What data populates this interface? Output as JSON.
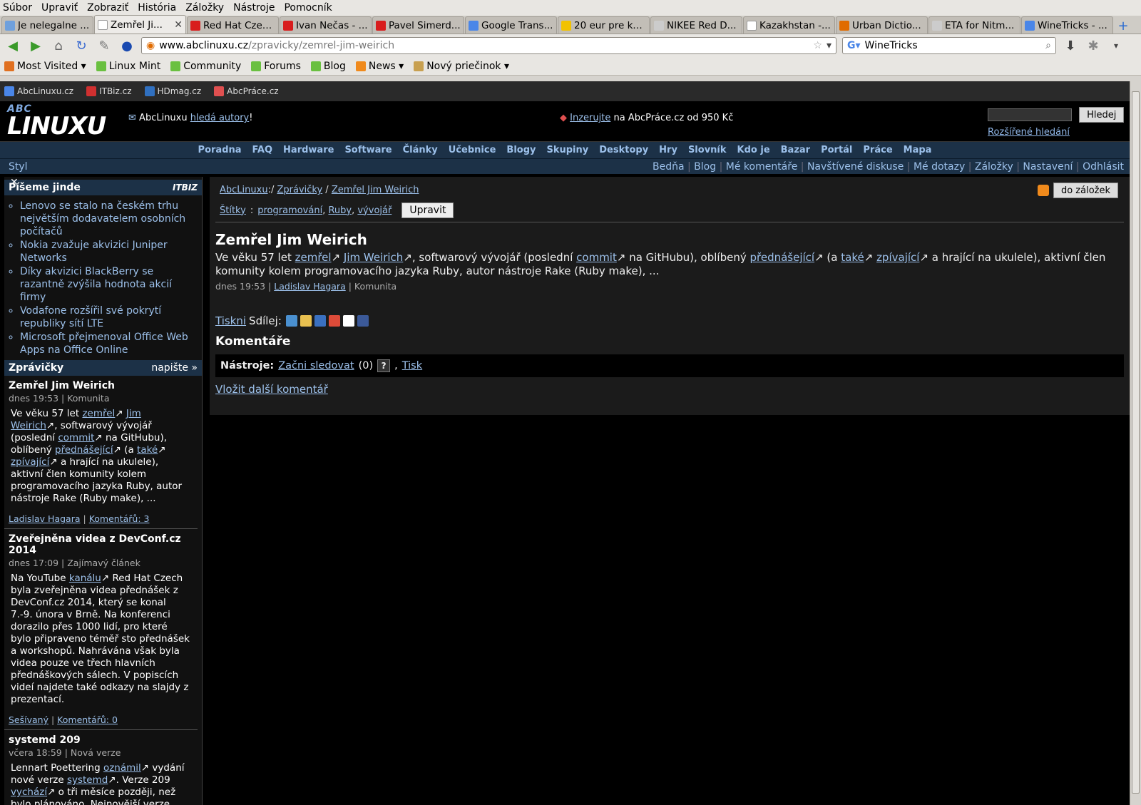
{
  "menubar": [
    "Súbor",
    "Upraviť",
    "Zobraziť",
    "História",
    "Záložky",
    "Nástroje",
    "Pomocník"
  ],
  "tabs": [
    {
      "label": "Je nelegalne ...",
      "color": "#6fa0dc"
    },
    {
      "label": "Zemřel Ji...",
      "color": "#ffffff",
      "active": true
    },
    {
      "label": "Red Hat Czec...",
      "color": "#d81d1d"
    },
    {
      "label": "Ivan Nečas - ...",
      "color": "#d81d1d"
    },
    {
      "label": "Pavel Simerd...",
      "color": "#d81d1d"
    },
    {
      "label": "Google Trans...",
      "color": "#4a86e8"
    },
    {
      "label": "20 eur pre ka...",
      "color": "#f2c200"
    },
    {
      "label": "NIKEE Red D...",
      "color": "#cccccc"
    },
    {
      "label": "Kazakhstan -...",
      "color": "#ffffff"
    },
    {
      "label": "Urban Dictio...",
      "color": "#e06b00"
    },
    {
      "label": "ETA for Nitm...",
      "color": "#cccccc"
    },
    {
      "label": "WineTricks - ...",
      "color": "#4a86e8"
    }
  ],
  "tab_close": "✕",
  "url": {
    "host": "www.abclinuxu.cz",
    "path": "/zpravicky/zemrel-jim-weirich"
  },
  "search": {
    "value": "WineTricks"
  },
  "bookmarks": [
    "Most Visited",
    "Linux Mint",
    "Community",
    "Forums",
    "Blog",
    "News",
    "Nový priečinok"
  ],
  "sites": [
    "AbcLinuxu.cz",
    "ITBiz.cz",
    "HDmag.cz",
    "AbcPráce.cz"
  ],
  "header": {
    "logo_top": "ABC",
    "logo_main": "LINUXU",
    "authors_pre": "AbcLinuxu ",
    "authors_link": "hledá autory",
    "authors_post": "!",
    "ad_link": "Inzerujte",
    "ad_text": " na AbcPráce.cz od 950 Kč",
    "search_button": "Hledej",
    "adv_search": "Rozšířené hledání"
  },
  "mainnav": [
    "Poradna",
    "FAQ",
    "Hardware",
    "Software",
    "Články",
    "Učebnice",
    "Blogy",
    "Skupiny",
    "Desktopy",
    "Hry",
    "Slovník",
    "Kdo je",
    "Bazar",
    "Portál",
    "Práce",
    "Mapa"
  ],
  "usernav": {
    "left": "Styl",
    "links": [
      "Bedňa",
      "Blog",
      "Mé komentáře",
      "Navštívené diskuse",
      "Mé dotazy",
      "Záložky",
      "Nastavení",
      "Odhlásit"
    ]
  },
  "sidebar": {
    "close": "✕",
    "box_title": "Píšeme jinde",
    "box_brand": "ITBIZ",
    "links": [
      "Lenovo se stalo na českém trhu největším dodavatelem osobních počítačů",
      "Nokia zvažuje akvizici Juniper Networks",
      "Díky akvizici BlackBerry se razantně zvýšila hodnota akcií firmy",
      "Vodafone rozšířil své pokrytí republiky sítí LTE",
      "Microsoft přejmenoval Office Web Apps na Office Online"
    ],
    "news_title": "Zprávičky",
    "news_write": "napište »",
    "news": [
      {
        "title": "Zemřel Jim Weirich",
        "meta": "dnes 19:53 | Komunita",
        "html": "Ve věku 57 let <a>zemřel</a>↗ <a>Jim Weirich</a>↗, softwarový vývojář (poslední <a>commit</a>↗ na GitHubu), oblíbený <a>přednášející</a>↗ (a <a>také</a>↗ <a>zpívající</a>↗ a hrající na ukulele), aktivní člen komunity kolem programovacího jazyka Ruby, autor nástroje Rake (Ruby make), ...",
        "author": "Ladislav Hagara",
        "comments": "Komentářů: 3"
      },
      {
        "title": "Zveřejněna videa z DevConf.cz 2014",
        "meta": "dnes 17:09 | Zajímavý článek",
        "html": "Na YouTube <a>kanálu</a>↗ Red Hat Czech byla zveřejněna videa přednášek z DevConf.cz 2014, který se konal 7.-9. února v Brně. Na konferenci dorazilo přes 1000 lidí, pro které bylo připraveno téměř sto přednášek a workshopů. Nahrávána však byla videa pouze ve třech hlavních přednáškových sálech. V popiscích videí najdete také odkazy na slajdy z prezentací.",
        "author": "Sešívaný",
        "comments": "Komentářů: 0"
      },
      {
        "title": "systemd 209",
        "meta": "včera 18:59 | Nová verze",
        "html": "Lennart Poettering <a>oznámil</a>↗ vydání nové verze <a>systemd</a>↗. Verze 209 <a>vychází</a>↗ o tři měsíce později, než bylo plánováno. Nejnovější verze",
        "author": "",
        "comments": ""
      }
    ]
  },
  "article": {
    "crumb": [
      {
        "t": "AbcLinuxu",
        "link": true
      },
      {
        "t": ":/ ",
        "link": false
      },
      {
        "t": "Zprávičky",
        "link": true
      },
      {
        "t": " / ",
        "link": false
      },
      {
        "t": "Zemřel Jim Weirich",
        "link": true
      }
    ],
    "bookmark_button": "do záložek",
    "tags_label": "Štítky",
    "tags": [
      "programování",
      "Ruby",
      "vývojář"
    ],
    "edit_button": "Upravit",
    "title": "Zemřel Jim Weirich",
    "body_html": "Ve věku 57 let <a>zemřel</a>↗ <a>Jim Weirich</a>↗, softwarový vývojář (poslední <a>commit</a>↗ na GitHubu), oblíbený <a>přednášející</a>↗ (a <a>také</a>↗ <a>zpívající</a>↗ a hrající na ukulele), aktivní člen komunity kolem programovacího jazyka Ruby, autor nástroje Rake (Ruby make), ...",
    "meta_time": "dnes 19:53",
    "author": "Ladislav Hagara",
    "section": "Komunita",
    "print": "Tiskni",
    "share": "Sdílej:",
    "share_icons": [
      {
        "name": "linkuj-icon",
        "color": "#4a90d0"
      },
      {
        "name": "jagg-icon",
        "color": "#e8c050"
      },
      {
        "name": "topclanky-icon",
        "color": "#3a70c0"
      },
      {
        "name": "google-icon",
        "color": "#dd4b39"
      },
      {
        "name": "delicious-icon",
        "color": "#ffffff"
      },
      {
        "name": "facebook-icon",
        "color": "#3b5998"
      }
    ],
    "comments_heading": "Komentáře",
    "tools_label": "Nástroje:",
    "follow": "Začni sledovat",
    "follow_count": "(0)",
    "help": "?",
    "print2": "Tisk",
    "add_comment": "Vložit další komentář"
  }
}
